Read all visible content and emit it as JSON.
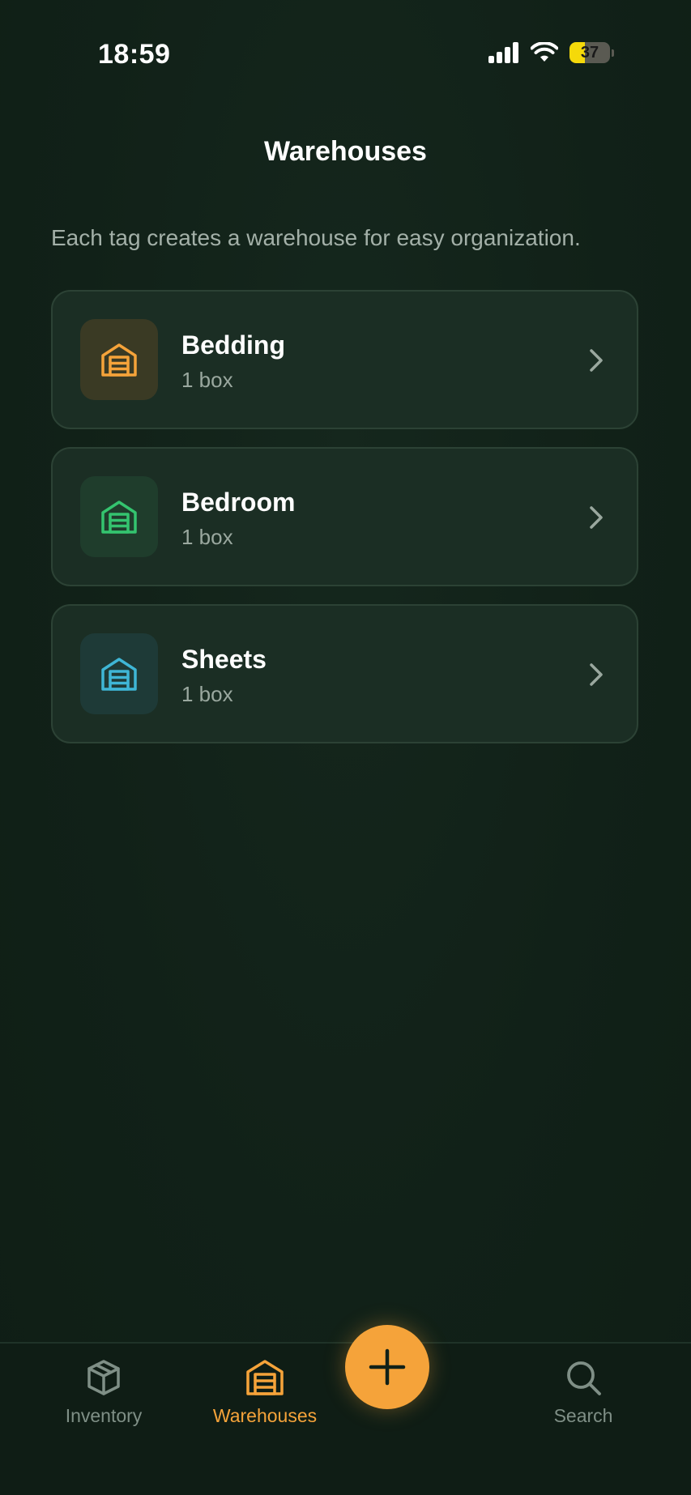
{
  "status_bar": {
    "time": "18:59",
    "battery": 37
  },
  "header": {
    "title": "Warehouses",
    "subtitle": "Each tag creates a warehouse for easy organization."
  },
  "warehouses": [
    {
      "name": "Bedding",
      "count": "1 box",
      "icon": "warehouse-icon",
      "color": "#f5a33a",
      "tile_color": "#3a3a24"
    },
    {
      "name": "Bedroom",
      "count": "1 box",
      "icon": "warehouse-icon",
      "color": "#34c46f",
      "tile_color": "#1f3d2c"
    },
    {
      "name": "Sheets",
      "count": "1 box",
      "icon": "warehouse-icon",
      "color": "#3fb6d6",
      "tile_color": "#1e3a37"
    }
  ],
  "tab_bar": {
    "tabs": [
      {
        "label": "Inventory",
        "icon": "cube-icon",
        "active": false
      },
      {
        "label": "Warehouses",
        "icon": "warehouse-icon",
        "active": true
      },
      {
        "label": "Search",
        "icon": "search-icon",
        "active": false
      }
    ],
    "fab_icon": "plus-icon"
  },
  "colors": {
    "background": "#112118",
    "card": "#1b2e24",
    "accent": "#f5a33a",
    "inactive": "#7f8f86"
  }
}
